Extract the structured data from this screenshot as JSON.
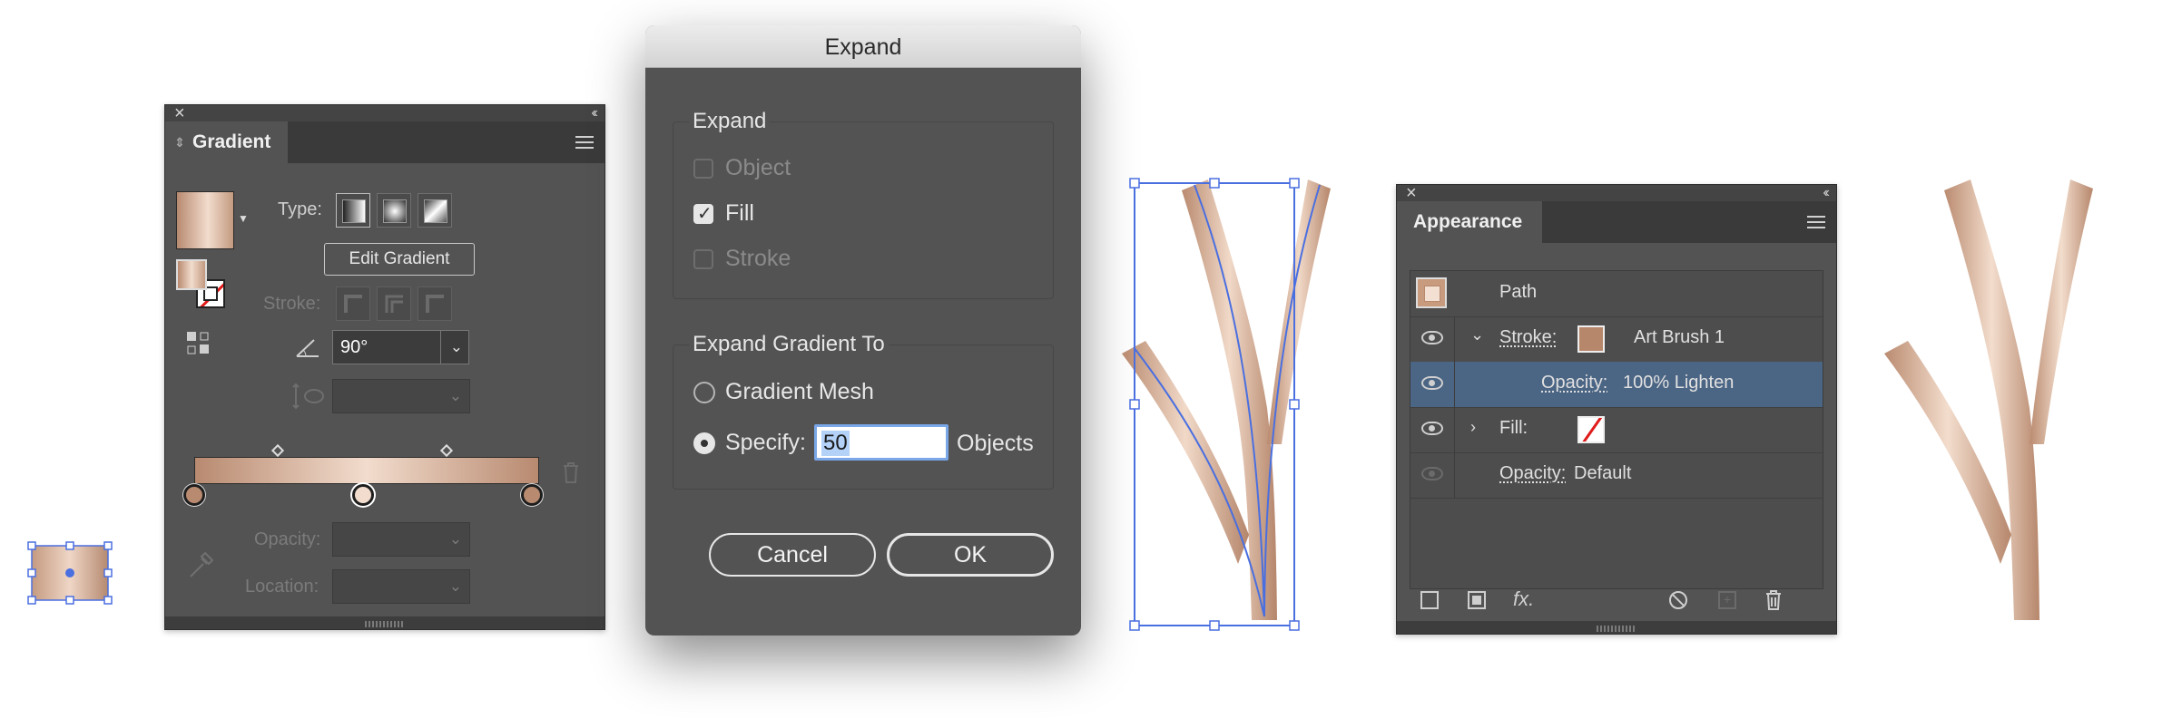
{
  "gradient_panel": {
    "tab_label": "Gradient",
    "type_label": "Type:",
    "tooltip": "Edit Gradient",
    "stroke_label": "Stroke:",
    "angle_value": "90°",
    "opacity_label": "Opacity:",
    "location_label": "Location:",
    "colors": {
      "gradient_dark": "#b88a70",
      "gradient_light": "#f2dccd"
    }
  },
  "expand_dialog": {
    "title": "Expand",
    "expand_group": "Expand",
    "options": [
      {
        "label": "Object",
        "checked": false,
        "enabled": false
      },
      {
        "label": "Fill",
        "checked": true,
        "enabled": true
      },
      {
        "label": "Stroke",
        "checked": false,
        "enabled": false
      }
    ],
    "gradient_group": "Expand Gradient To",
    "gradient_mesh_label": "Gradient Mesh",
    "specify_label": "Specify:",
    "specify_value": "50",
    "objects_label": "Objects",
    "cancel_label": "Cancel",
    "ok_label": "OK"
  },
  "appearance_panel": {
    "tab_label": "Appearance",
    "path_label": "Path",
    "stroke_label": "Stroke:",
    "stroke_value": "Art Brush 1",
    "stroke_opacity_label": "Opacity:",
    "stroke_opacity_value": "100% Lighten",
    "fill_label": "Fill:",
    "opacity_label": "Opacity:",
    "opacity_value": "Default",
    "fx_label": "fx."
  },
  "colors": {
    "accent_selection": "#4b6584",
    "path_blue": "#4a6fe0"
  }
}
